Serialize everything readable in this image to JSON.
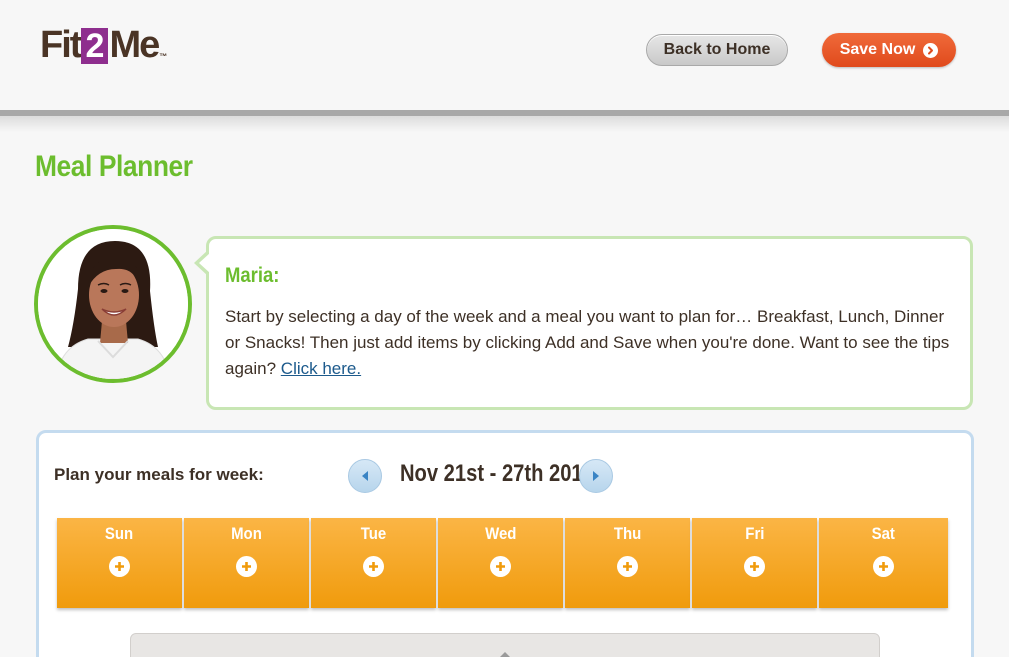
{
  "header": {
    "logo": {
      "part1": "Fit",
      "part2": "2",
      "part3": "Me",
      "mark": "™"
    },
    "back_home_label": "Back to Home",
    "save_label": "Save Now"
  },
  "page_title": "Meal Planner",
  "coach": {
    "name": "Maria:",
    "message": "Start by selecting a day of the week and a meal you want to plan for… Breakfast, Lunch, Dinner or Snacks! Then just add items by clicking Add and Save when you're done. Want to see the tips again?",
    "link_text": "Click here."
  },
  "planner": {
    "label": "Plan your meals for week:",
    "week_range": "Nov 21st - 27th 2016",
    "days": [
      "Sun",
      "Mon",
      "Tue",
      "Wed",
      "Thu",
      "Fri",
      "Sat"
    ]
  },
  "colors": {
    "brand_green": "#6cbd2e",
    "brand_purple": "#8e2e8e",
    "save_orange": "#e8531f",
    "day_orange": "#f5a623",
    "panel_blue": "#c4dbef"
  },
  "icons": {
    "save_button": "arrow-right-circle-icon",
    "prev_week": "triangle-left-icon",
    "next_week": "triangle-right-icon",
    "add_meal": "plus-circle-icon"
  }
}
